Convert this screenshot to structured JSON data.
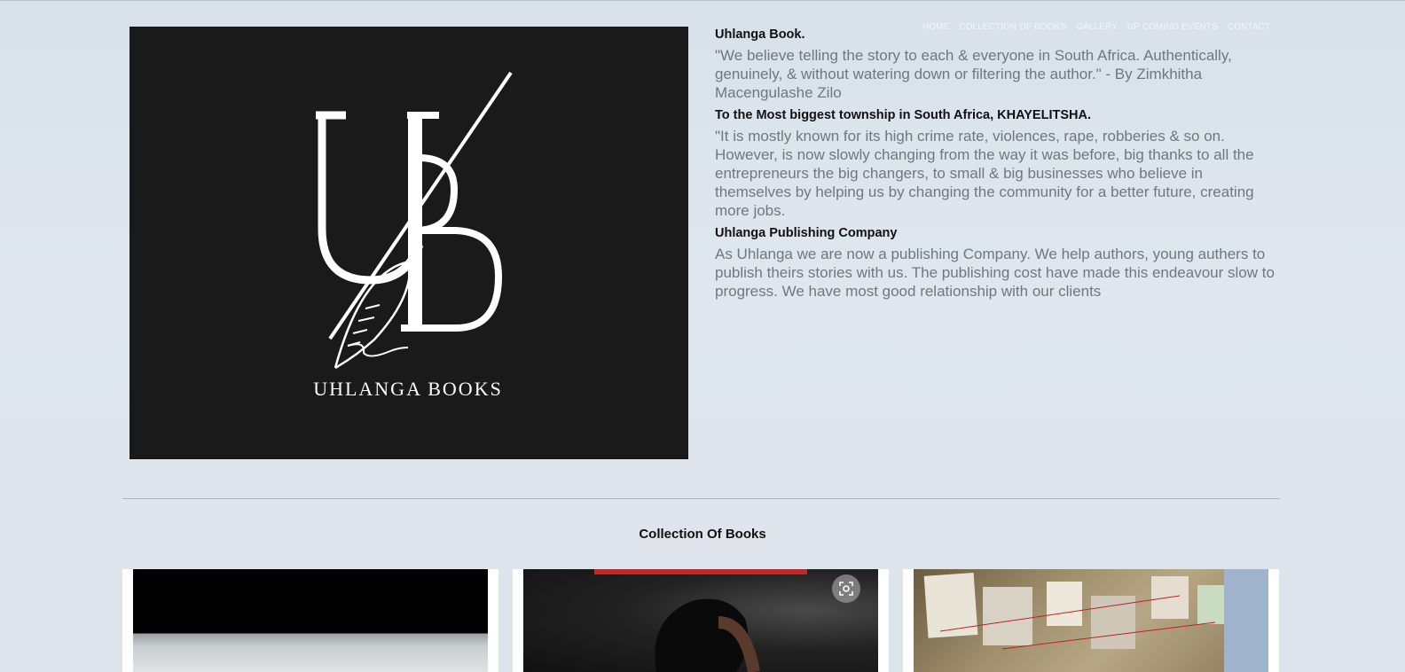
{
  "nav": {
    "items": [
      "HOME",
      "COLLECTION OF BOOKS",
      "GALLERY",
      "UP COMING EVENTS",
      "CONTACT"
    ]
  },
  "logo": {
    "wordmark": "UHLANGA BOOKS",
    "monogram": "UB"
  },
  "content": {
    "h1": "Uhlanga Book.",
    "p1": "\"We believe telling the story to each & everyone in South Africa. Authentically, genuinely, & without watering down or filtering the author.\" - By Zimkhitha Macengulashe Zilo",
    "h2": "To the Most biggest township in South Africa, KHAYELITSHA.",
    "p2": "\"It is mostly known for its high crime rate, violences, rape, robberies & so on. However, is now slowly changing from the way it was before, big thanks to all the entrepreneurs the big changers, to small & big businesses who believe in themselves by helping us by changing the community for a better future, creating more jobs.",
    "h3": "Uhlanga Publishing Company",
    "p3": "As Uhlanga we are now a publishing Company. We help authors, young authers to publish theirs stories with us. The publishing cost have made this endeavour slow to progress. We have most good relationship with our clients"
  },
  "collection": {
    "title": "Collection Of Books"
  },
  "colors": {
    "background": "#dce3eb",
    "logo_bg": "#1a1a1a",
    "body_text": "#6f7780",
    "heading_text": "#111111"
  }
}
